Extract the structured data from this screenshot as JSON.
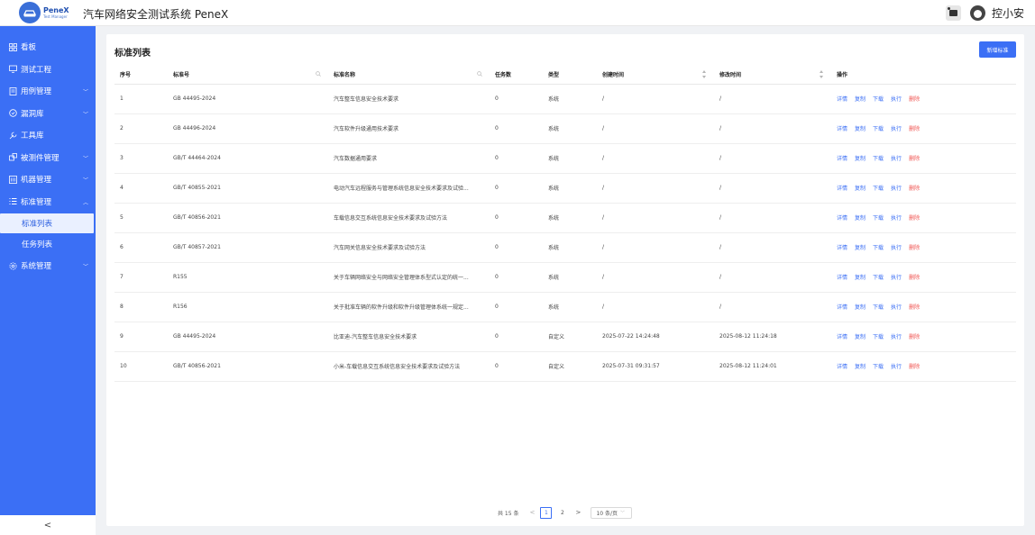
{
  "header": {
    "logo_name": "PeneX",
    "logo_sub": "Test Manager",
    "app_title": "汽车网络安全测试系统 PeneX",
    "user_name": "控小安"
  },
  "sidebar": {
    "items": [
      {
        "label": "看板",
        "icon": "dashboard-icon"
      },
      {
        "label": "测试工程",
        "icon": "monitor-icon"
      },
      {
        "label": "用例管理",
        "icon": "document-icon",
        "expandable": true
      },
      {
        "label": "漏洞库",
        "icon": "shield-icon",
        "expandable": true
      },
      {
        "label": "工具库",
        "icon": "wrench-icon"
      },
      {
        "label": "被测件管理",
        "icon": "component-icon",
        "expandable": true
      },
      {
        "label": "机器管理",
        "icon": "machine-icon",
        "expandable": true
      },
      {
        "label": "标准管理",
        "icon": "list-icon",
        "expandable": true,
        "expanded": true
      },
      {
        "label": "系统管理",
        "icon": "gear-icon",
        "expandable": true
      }
    ],
    "sub_items": [
      {
        "label": "标准列表",
        "active": true
      },
      {
        "label": "任务列表",
        "active": false
      }
    ],
    "collapse_label": "<"
  },
  "main": {
    "title": "标准列表",
    "add_button": "新增标准",
    "columns": [
      "序号",
      "标准号",
      "标准名称",
      "任务数",
      "类型",
      "创建时间",
      "修改时间",
      "操作"
    ],
    "rows": [
      {
        "idx": "1",
        "code": "GB 44495-2024",
        "name": "汽车整车信息安全技术要求",
        "tasks": "0",
        "type": "系统",
        "created": "/",
        "modified": "/"
      },
      {
        "idx": "2",
        "code": "GB 44496-2024",
        "name": "汽车软件升级通用技术要求",
        "tasks": "0",
        "type": "系统",
        "created": "/",
        "modified": "/"
      },
      {
        "idx": "3",
        "code": "GB/T 44464-2024",
        "name": "汽车数据通用要求",
        "tasks": "0",
        "type": "系统",
        "created": "/",
        "modified": "/"
      },
      {
        "idx": "4",
        "code": "GB/T 40855-2021",
        "name": "电动汽车远程服务与管理系统信息安全技术要求及试验...",
        "tasks": "0",
        "type": "系统",
        "created": "/",
        "modified": "/"
      },
      {
        "idx": "5",
        "code": "GB/T 40856-2021",
        "name": "车载信息交互系统信息安全技术要求及试验方法",
        "tasks": "0",
        "type": "系统",
        "created": "/",
        "modified": "/"
      },
      {
        "idx": "6",
        "code": "GB/T 40857-2021",
        "name": "汽车网关信息安全技术要求及试验方法",
        "tasks": "0",
        "type": "系统",
        "created": "/",
        "modified": "/"
      },
      {
        "idx": "7",
        "code": "R155",
        "name": "关于车辆网络安全与网络安全管理体系型式认定的统一...",
        "tasks": "0",
        "type": "系统",
        "created": "/",
        "modified": "/"
      },
      {
        "idx": "8",
        "code": "R156",
        "name": "关于批准车辆的软件升级和软件升级管理体系统一规定...",
        "tasks": "0",
        "type": "系统",
        "created": "/",
        "modified": "/"
      },
      {
        "idx": "9",
        "code": "GB 44495-2024",
        "name": "比亚迪-汽车整车信息安全技术要求",
        "tasks": "0",
        "type": "自定义",
        "created": "2025-07-22 14:24:48",
        "modified": "2025-08-12 11:24:18"
      },
      {
        "idx": "10",
        "code": "GB/T 40856-2021",
        "name": "小米-车载信息交互系统信息安全技术要求及试验方法",
        "tasks": "0",
        "type": "自定义",
        "created": "2025-07-31 09:31:57",
        "modified": "2025-08-12 11:24:01"
      }
    ],
    "actions": {
      "detail": "详情",
      "copy": "复制",
      "download": "下载",
      "execute": "执行",
      "delete": "删除"
    }
  },
  "pagination": {
    "total": "共 15 条",
    "pages": [
      "1",
      "2"
    ],
    "current": "1",
    "page_size": "10 条/页"
  },
  "colors": {
    "sidebar": "#3b6ff5",
    "accent": "#3b6ff5",
    "delete": "#f0524f"
  }
}
